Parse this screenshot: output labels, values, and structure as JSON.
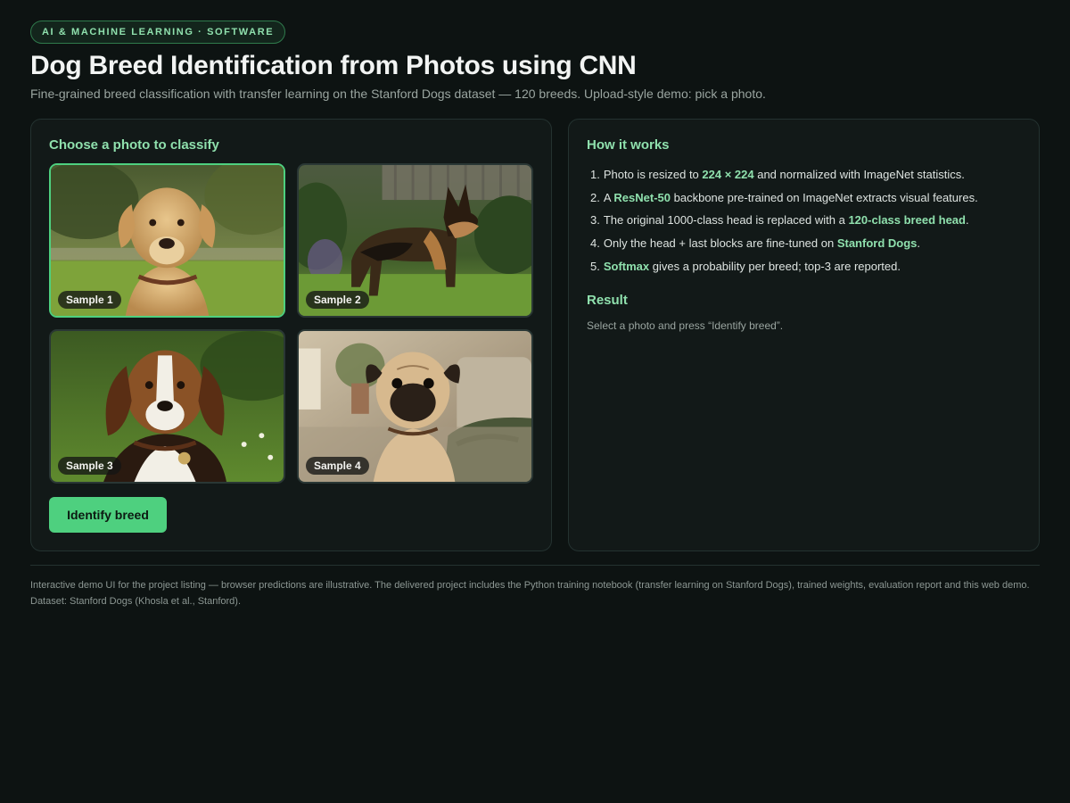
{
  "badge": "AI & MACHINE LEARNING · SOFTWARE",
  "title": "Dog Breed Identification from Photos using CNN",
  "subtitle": "Fine-grained breed classification with transfer learning on the Stanford Dogs dataset — 120 breeds. Upload-style demo: pick a photo.",
  "chooser": {
    "heading": "Choose a photo to classify",
    "samples": [
      {
        "label": "Sample 1",
        "selected": true
      },
      {
        "label": "Sample 2",
        "selected": false
      },
      {
        "label": "Sample 3",
        "selected": false
      },
      {
        "label": "Sample 4",
        "selected": false
      }
    ],
    "button_label": "Identify breed"
  },
  "how_it_works": {
    "heading": "How it works",
    "steps": [
      {
        "num": "1.",
        "a": "Photo is resized to ",
        "b": "224 × 224",
        "c": " and normalized with ImageNet statistics."
      },
      {
        "num": "2.",
        "a": "A ",
        "b": "ResNet-50",
        "c": " backbone pre-trained on ImageNet extracts visual features."
      },
      {
        "num": "3.",
        "a": "The original 1000-class head is replaced with a ",
        "b": "120-class breed head",
        "c": "."
      },
      {
        "num": "4.",
        "a": "Only the head + last blocks are fine-tuned on ",
        "b": "Stanford Dogs",
        "c": "."
      },
      {
        "num": "5.",
        "a": "",
        "b": "Softmax",
        "c": " gives a probability per breed; top-3 are reported."
      }
    ]
  },
  "result": {
    "heading": "Result",
    "text": "Select a photo and press “Identify breed”."
  },
  "footer": "Interactive demo UI for the project listing — browser predictions are illustrative. The delivered project includes the Python training notebook (transfer learning on Stanford Dogs), trained weights, evaluation report and this web demo. Dataset: Stanford Dogs (Khosla et al., Stanford).",
  "colors": {
    "accent": "#4ed07f",
    "accent_text": "#8fe0ad",
    "background": "#0d1312",
    "panel": "#121918"
  }
}
